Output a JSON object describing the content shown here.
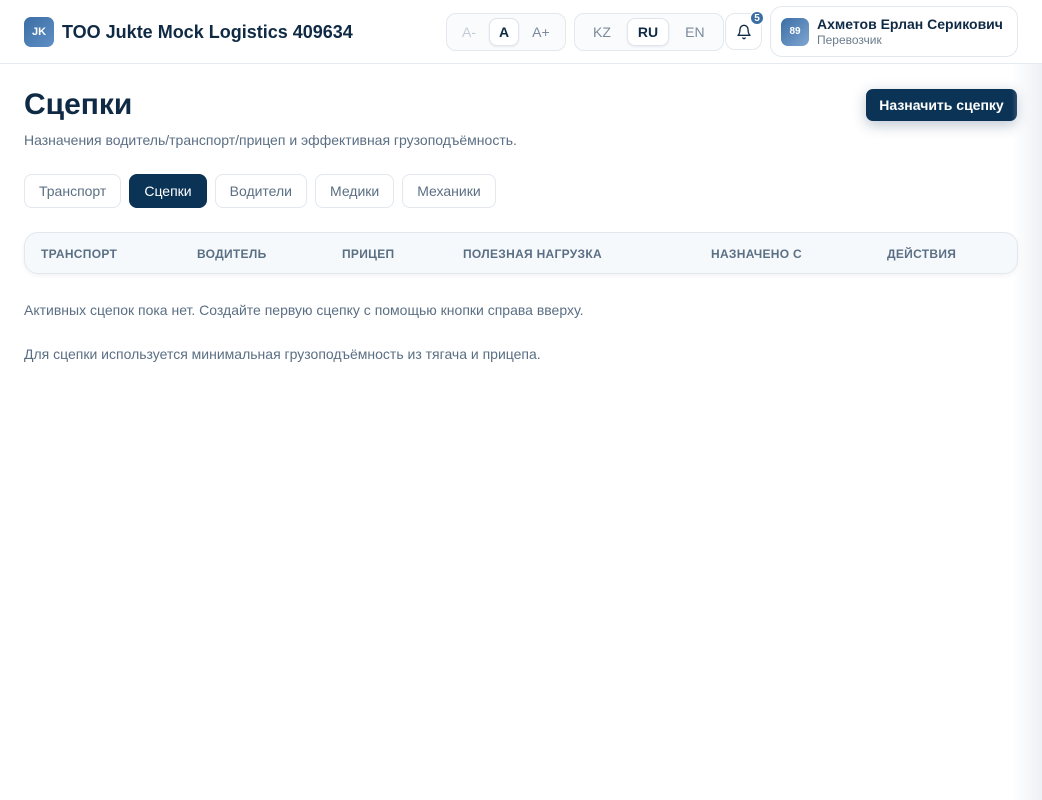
{
  "header": {
    "logo_text": "JK",
    "company_name": "TOO Jukte Mock Logistics 409634",
    "font_size_controls": [
      "A-",
      "A",
      "A+"
    ],
    "languages": [
      "KZ",
      "RU",
      "EN"
    ],
    "active_language": "RU",
    "notifications_count": "5",
    "user": {
      "avatar_text": "89",
      "name": "Ахметов Ерлан Серикович",
      "role": "Перевозчик"
    }
  },
  "page": {
    "title": "Сцепки",
    "subtitle": "Назначения водитель/транспорт/прицеп и эффективная грузоподъёмность.",
    "primary_action": "Назначить сцепку"
  },
  "tabs": [
    {
      "label": "Транспорт",
      "active": false
    },
    {
      "label": "Сцепки",
      "active": true
    },
    {
      "label": "Водители",
      "active": false
    },
    {
      "label": "Медики",
      "active": false
    },
    {
      "label": "Механики",
      "active": false
    }
  ],
  "table": {
    "columns": [
      "ТРАНСПОРТ",
      "ВОДИТЕЛЬ",
      "ПРИЦЕП",
      "ПОЛЕЗНАЯ НАГРУЗКА",
      "НАЗНАЧЕНО С",
      "ДЕЙСТВИЯ"
    ],
    "rows": []
  },
  "empty_state": "Активных сцепок пока нет. Создайте первую сцепку с помощью кнопки справа вверху.",
  "note": "Для сцепки используется минимальная грузоподъёмность из тягача и прицепа.",
  "colors": {
    "primary": "#0b3356",
    "accent": "#3b6ea5",
    "muted_text": "#5b6f84"
  }
}
